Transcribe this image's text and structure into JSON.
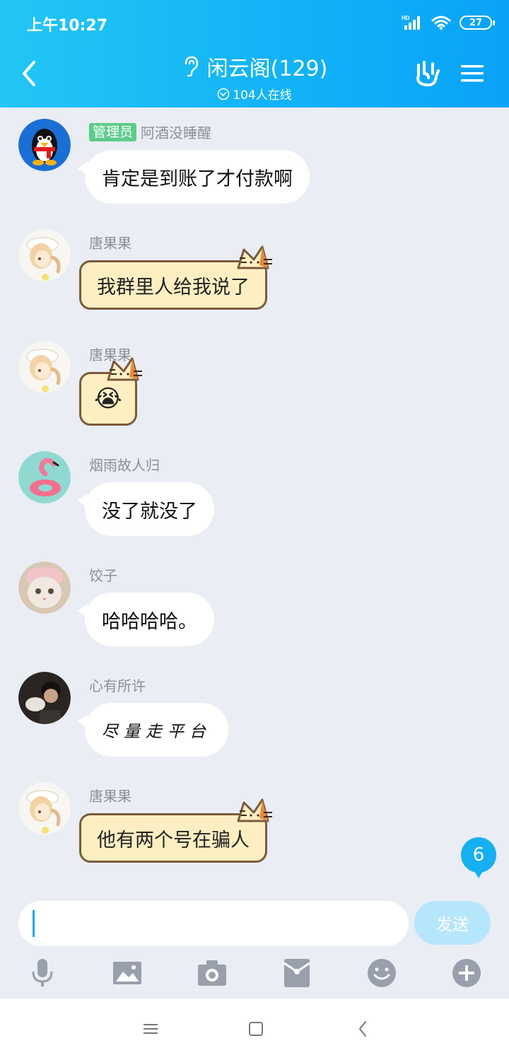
{
  "status_bar": {
    "time": "上午10:27",
    "network": "HD",
    "battery": "27"
  },
  "header": {
    "title": "闲云阁(129)",
    "online": "104人在线"
  },
  "messages": [
    {
      "sender": "阿酒没睡醒",
      "badge": "管理员",
      "text": "肯定是到账了才付款啊",
      "style": "plain",
      "avatar": "penguin"
    },
    {
      "sender": "唐果果",
      "text": "我群里人给我说了",
      "style": "cat",
      "avatar": "anime-girl"
    },
    {
      "sender": "唐果果",
      "text": "😭",
      "style": "cat",
      "avatar": "anime-girl"
    },
    {
      "sender": "烟雨故人归",
      "text": "没了就没了",
      "style": "plain",
      "avatar": "flamingo"
    },
    {
      "sender": "饺子",
      "text": "哈哈哈哈。",
      "style": "plain",
      "avatar": "cat-photo"
    },
    {
      "sender": "心有所许",
      "text": "尽量走平台",
      "style": "handwriting",
      "avatar": "photo"
    },
    {
      "sender": "唐果果",
      "text": "他有两个号在骗人",
      "style": "cat",
      "avatar": "anime-girl"
    }
  ],
  "unread_count": "6",
  "composer": {
    "placeholder": "",
    "send_label": "发送"
  },
  "toolbar": [
    "microphone-icon",
    "image-icon",
    "camera-icon",
    "red-packet-icon",
    "emoji-icon",
    "plus-icon"
  ],
  "colors": {
    "header_start": "#23c6f5",
    "header_end": "#0aa2f7",
    "admin_badge": "#5dcc8a",
    "cat_bubble": "#fdefc2",
    "send_disabled": "#b6e6fb"
  }
}
